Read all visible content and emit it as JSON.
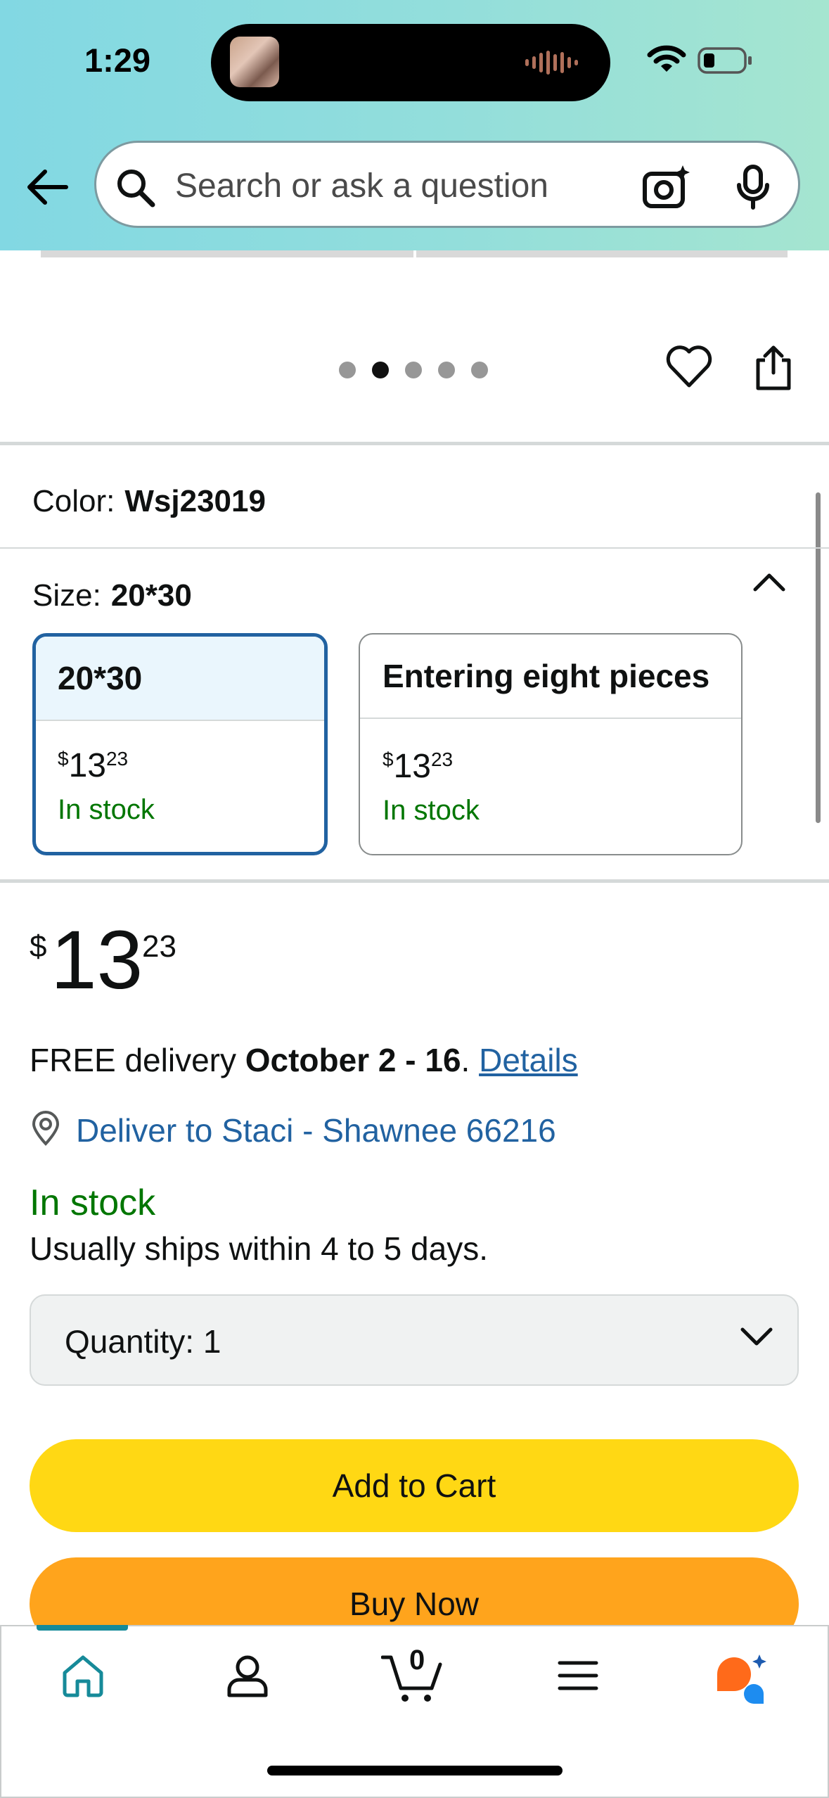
{
  "status_bar": {
    "time": "1:29"
  },
  "header": {
    "search_placeholder": "Search or ask a question"
  },
  "gallery": {
    "dot_count": 5,
    "active_dot": 1
  },
  "variations": {
    "color_label": "Color:",
    "color_value": "Wsj23019",
    "size_label": "Size:",
    "size_value": "20*30",
    "options": [
      {
        "name": "20*30",
        "price_symbol": "$",
        "price_whole": "13",
        "price_fraction": "23",
        "stock": "In stock",
        "selected": true
      },
      {
        "name": "Entering eight pieces",
        "price_symbol": "$",
        "price_whole": "13",
        "price_fraction": "23",
        "stock": "In stock",
        "selected": false
      }
    ]
  },
  "buy_box": {
    "price_symbol": "$",
    "price_whole": "13",
    "price_fraction": "23",
    "delivery_prefix": "FREE delivery ",
    "delivery_dates": "October 2 - 16",
    "delivery_period": ". ",
    "details_link": "Details",
    "deliver_to": "Deliver to Staci - Shawnee 66216",
    "stock_status": "In stock",
    "ships_note": "Usually ships within 4 to 5 days.",
    "quantity_label": "Quantity:",
    "quantity_value": "1",
    "add_to_cart": "Add to Cart",
    "buy_now": "Buy Now"
  },
  "bottom_nav": {
    "cart_count": "0",
    "items": [
      "home",
      "account",
      "cart",
      "menu",
      "rufus"
    ]
  },
  "colors": {
    "header_gradient_start": "#82d8e3",
    "header_gradient_end": "#a5e5d0",
    "link_blue": "#2162a1",
    "stock_green": "#007600",
    "add_to_cart_yellow": "#ffd814",
    "buy_now_orange": "#ffa41c",
    "selected_border": "#2162a1"
  }
}
